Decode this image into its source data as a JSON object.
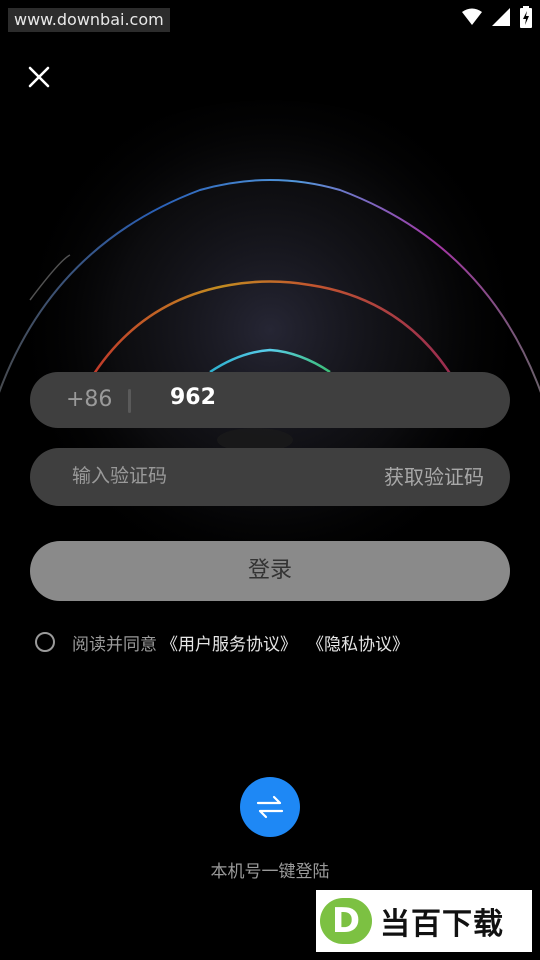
{
  "status_bar": {
    "watermark_url": "www.downbai.com",
    "icons": [
      "wifi-icon",
      "signal-icon",
      "battery-charging-icon"
    ]
  },
  "close_icon": "close-icon",
  "login_form": {
    "country_code": "+86",
    "phone_value": "962",
    "code_placeholder": "输入验证码",
    "get_code_label": "获取验证码",
    "submit_label": "登录"
  },
  "agreement": {
    "prefix": "阅读并同意",
    "user_agreement_link": "《用户服务协议》",
    "privacy_link": "《隐私协议》"
  },
  "one_key_login": {
    "icon": "swap-arrows-icon",
    "label": "本机号一键登陆"
  },
  "site_watermark": {
    "badge": "D",
    "text": "当百下载"
  },
  "colors": {
    "background": "#000000",
    "input_bg": "#3f3f3f",
    "login_button": "#8a8a8a",
    "accent_blue": "#1e88f5",
    "logo_green": "#7cc142"
  }
}
